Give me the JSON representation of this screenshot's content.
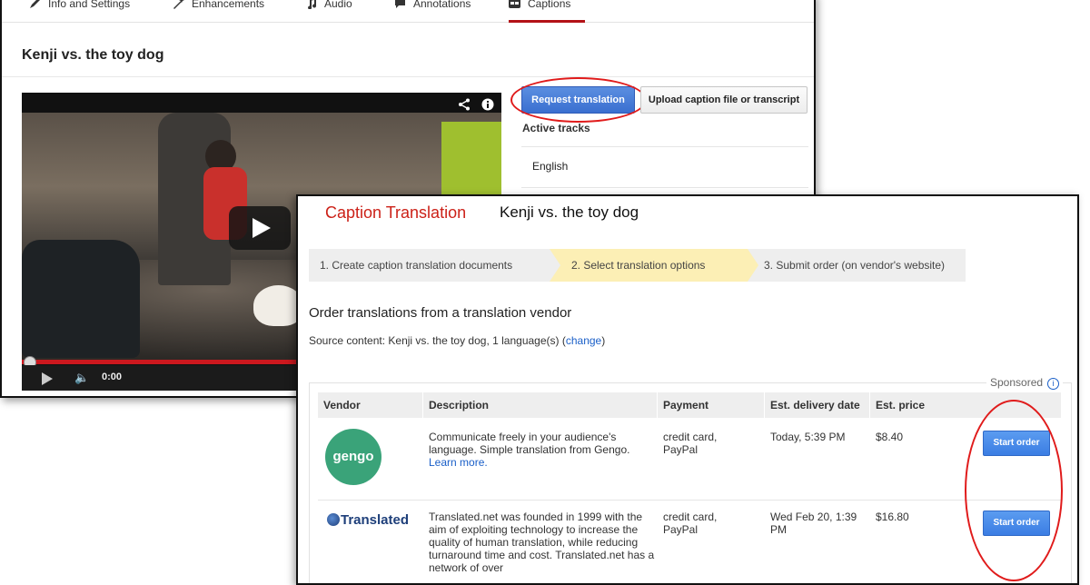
{
  "editor": {
    "tabs": [
      {
        "label": "Info and Settings",
        "icon": "pencil-icon"
      },
      {
        "label": "Enhancements",
        "icon": "wand-icon"
      },
      {
        "label": "Audio",
        "icon": "music-note-icon"
      },
      {
        "label": "Annotations",
        "icon": "speech-bubble-icon"
      },
      {
        "label": "Captions",
        "icon": "cc-icon"
      }
    ],
    "active_tab": "Captions",
    "video_title": "Kenji vs. the toy dog",
    "player": {
      "time": "0:00"
    },
    "request_translation_label": "Request translation",
    "upload_label": "Upload caption file or transcript",
    "active_tracks_label": "Active tracks",
    "tracks": [
      "English"
    ]
  },
  "translation": {
    "heading": "Caption Translation",
    "video_title": "Kenji vs. the toy dog",
    "steps": [
      "1. Create caption translation documents",
      "2. Select translation options",
      "3. Submit order (on vendor's website)"
    ],
    "current_step": 2,
    "order_heading": "Order translations from a translation vendor",
    "source_prefix": "Source content: Kenji vs. the toy dog, 1 language(s) (",
    "source_link": "change",
    "source_suffix": ")",
    "sponsored_label": "Sponsored",
    "columns": [
      "Vendor",
      "Description",
      "Payment",
      "Est. delivery date",
      "Est. price"
    ],
    "vendors": [
      {
        "logo_text": "gengo",
        "description": "Communicate freely in your audience's language. Simple translation from Gengo.",
        "learn_more": "Learn more.",
        "payment": "credit card, PayPal",
        "delivery": "Today, 5:39 PM",
        "price": "$8.40",
        "button": "Start order"
      },
      {
        "logo_text": "Translated",
        "description": "Translated.net was founded in 1999 with the aim of exploiting technology to increase the quality of human translation, while reducing turnaround time and cost. Translated.net has a network of over",
        "payment": "credit card, PayPal",
        "delivery": "Wed Feb 20, 1:39 PM",
        "price": "$16.80",
        "button": "Start order"
      }
    ]
  }
}
